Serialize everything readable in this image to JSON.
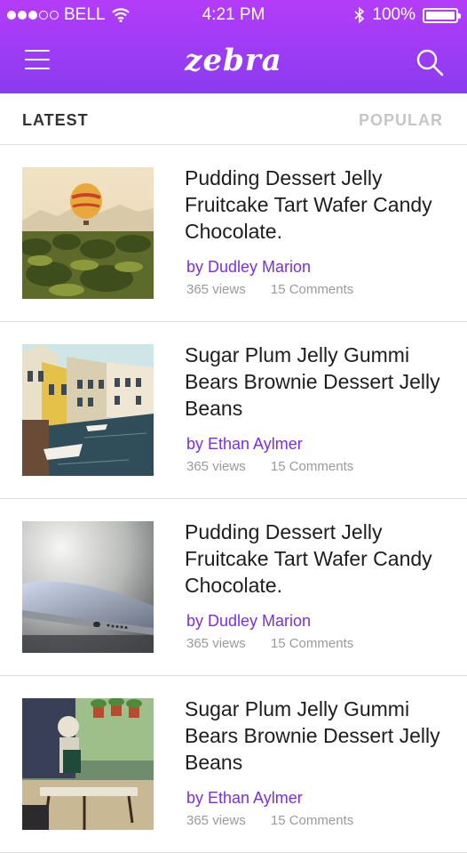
{
  "status_bar": {
    "carrier": "BELL",
    "time": "4:21 PM",
    "battery": "100%"
  },
  "header": {
    "logo": "zebra",
    "menu_icon": "hamburger-menu-icon",
    "search_icon": "search-icon"
  },
  "tabs": [
    {
      "label": "LATEST",
      "active": true
    },
    {
      "label": "POPULAR",
      "active": false
    }
  ],
  "articles": [
    {
      "title": "Pudding Dessert Jelly Fruitcake Tart Wafer Candy Chocolate.",
      "author": "by Dudley Marion",
      "views": "365 views",
      "comments": "15 Comments",
      "image": "hot-air-balloon-over-palm-trees"
    },
    {
      "title": "Sugar Plum Jelly Gummi Bears Brownie Dessert Jelly Beans",
      "author": "by Ethan Aylmer",
      "views": "365 views",
      "comments": "15 Comments",
      "image": "canal-houses-with-boats"
    },
    {
      "title": "Pudding Dessert Jelly Fruitcake Tart Wafer Candy Chocolate.",
      "author": "by Dudley Marion",
      "views": "365 views",
      "comments": "15 Comments",
      "image": "smartphone-closeup"
    },
    {
      "title": "Sugar Plum Jelly Gummi Bears Brownie Dessert Jelly Beans",
      "author": "by Ethan Aylmer",
      "views": "365 views",
      "comments": "15 Comments",
      "image": "cafe-with-chef-statue"
    }
  ],
  "colors": {
    "header_top": "#b43cf8",
    "header_bottom": "#8a3cf0",
    "author": "#7a2ee6",
    "inactive_tab": "#c6c6c6"
  }
}
